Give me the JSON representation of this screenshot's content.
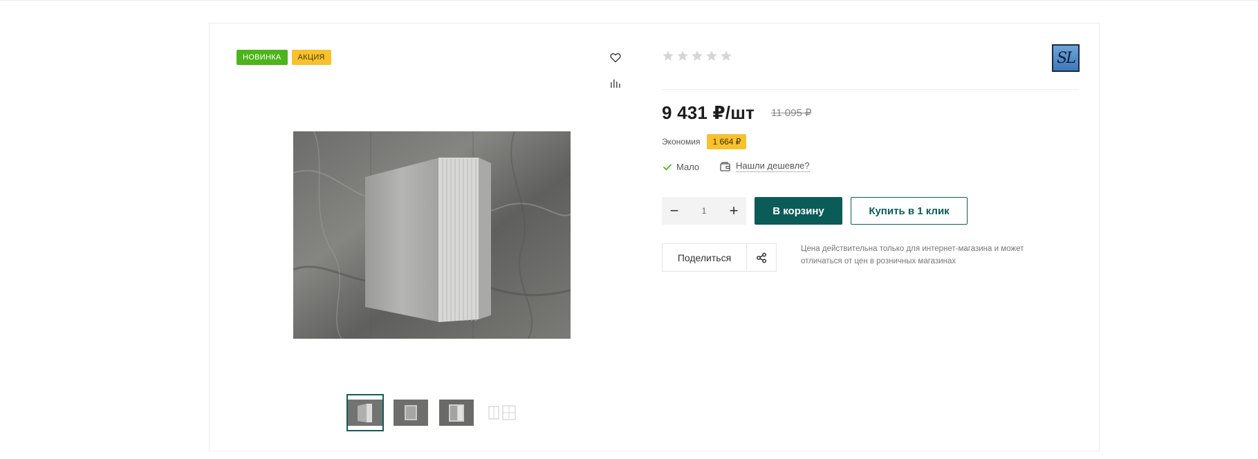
{
  "stickers": {
    "new": "НОВИНКА",
    "sale": "АКЦИЯ"
  },
  "icons": {
    "favorite": "heart-icon",
    "compare": "bar-chart-icon",
    "stock": "check-icon",
    "cheaper": "wallet-icon",
    "share": "share-icon"
  },
  "rating": {
    "stars": 5,
    "filled": 0
  },
  "brand": {
    "logo_text": "SL"
  },
  "price": {
    "current": "9 431 ₽/шт",
    "old": "11 095 ₽"
  },
  "economy": {
    "label": "Экономия",
    "value": "1 664 ₽"
  },
  "availability": {
    "label": "Мало"
  },
  "cheaper_link": "Нашли дешевле?",
  "quantity": {
    "value": "1",
    "minus": "−",
    "plus": "+"
  },
  "buttons": {
    "cart": "В корзину",
    "one_click": "Купить в 1 клик",
    "share": "Поделиться"
  },
  "note": "Цена действительна только для интернет-магазина и может отличаться от цен в розничных магазинах",
  "gallery": {
    "thumb_count": 4,
    "active_index": 0
  },
  "colors": {
    "accent": "#0b5c58",
    "sticker_new": "#4db41b",
    "sticker_sale": "#f8c22d",
    "check": "#4db41b"
  }
}
